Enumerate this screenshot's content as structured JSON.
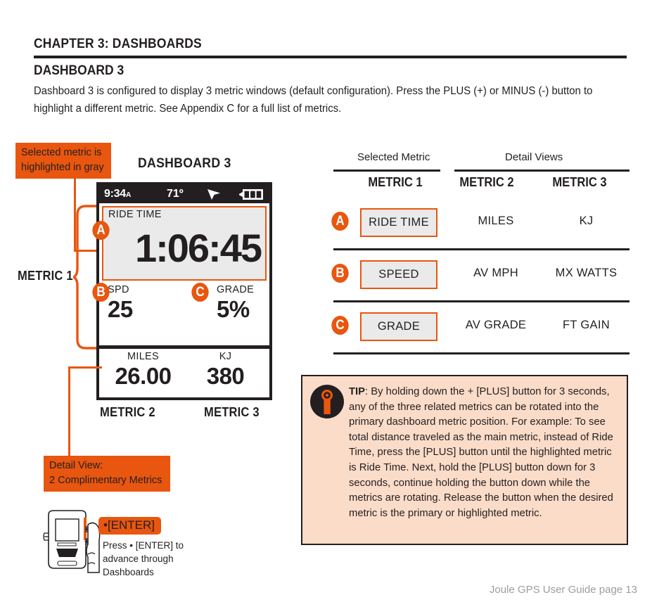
{
  "header": {
    "chapter": "CHAPTER 3: DASHBOARDS",
    "section": "DASHBOARD 3",
    "intro": "Dashboard 3 is configured to display 3 metric windows (default configuration). Press the PLUS (+) or MINUS (-) button to highlight a different metric. See Appendix C for a full list of metrics."
  },
  "callouts": {
    "selected_metric": "Selected metric is highlighted in gray",
    "detail_view": "Detail View:\n2 Complimentary Metrics",
    "detail_view_line1": "Detail View:",
    "detail_view_line2": "2 Complimentary Metrics"
  },
  "device": {
    "title": "DASHBOARD 3",
    "status": {
      "time": "9:34",
      "time_suffix": "A",
      "temperature": "71º",
      "nav_icon": "navigation-arrow-icon",
      "battery_icon": "battery-full-icon",
      "battery_bars": 3
    },
    "metric1": {
      "label": "RIDE TIME",
      "value": "1:06:45",
      "badge": "A",
      "highlighted": true
    },
    "metric1_sub": [
      {
        "label": "SPD",
        "value": "25",
        "badge": "B"
      },
      {
        "label": "GRADE",
        "value": "5%",
        "badge": "C"
      }
    ],
    "detail_metrics": [
      {
        "label": "MILES",
        "value": "26.00"
      },
      {
        "label": "KJ",
        "value": "380"
      }
    ],
    "annotations": {
      "metric1": "METRIC 1",
      "metric2": "METRIC 2",
      "metric3": "METRIC 3"
    }
  },
  "table": {
    "group_headers": {
      "selected": "Selected Metric",
      "detail": "Detail Views"
    },
    "columns": [
      "METRIC 1",
      "METRIC 2",
      "METRIC 3"
    ],
    "rows": [
      {
        "badge": "A",
        "selected": "RIDE TIME",
        "detail1": "MILES",
        "detail2": "KJ"
      },
      {
        "badge": "B",
        "selected": "SPEED",
        "detail1": "AV MPH",
        "detail2": "MX WATTS"
      },
      {
        "badge": "C",
        "selected": "GRADE",
        "detail1": "AV GRADE",
        "detail2": "FT GAIN"
      }
    ]
  },
  "tip": {
    "icon": "info-icon",
    "label": "TIP",
    "text": ": By holding down the + [PLUS] button for 3 seconds, any of the three related metrics can be rotated into the primary dashboard metric position. For example: To see total distance traveled as the main metric, instead of Ride Time, press the [PLUS] button until the highlighted metric is Ride Time. Next, hold the [PLUS] button down for 3 seconds, continue holding the button down while the metrics are rotating. Release the button when the desired metric is the primary or highlighted metric."
  },
  "enter": {
    "pill": "•[ENTER]",
    "caption": "Press • [ENTER] to advance through Dashboards"
  },
  "footer": "Joule GPS User Guide page 13",
  "colors": {
    "accent": "#e8560f",
    "ink": "#231f20",
    "tip_bg": "#fbdcc9",
    "highlight_gray": "#eaeaea"
  }
}
